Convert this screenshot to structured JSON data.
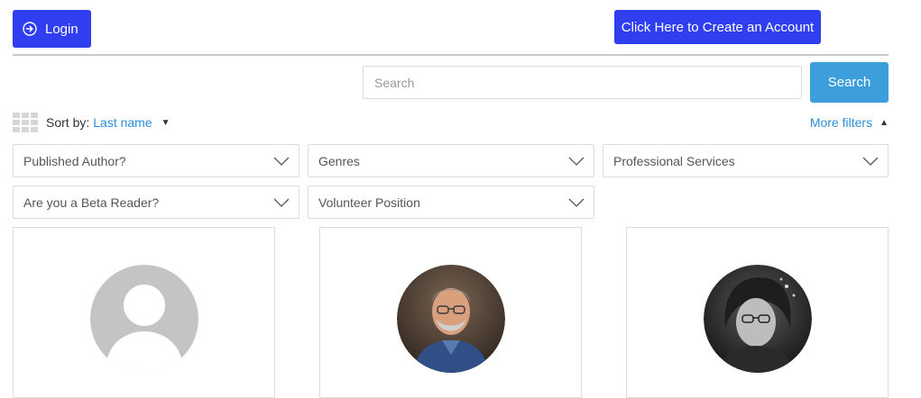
{
  "header": {
    "login_label": "Login",
    "create_account_label": "Click Here to Create an Account"
  },
  "search": {
    "placeholder": "Search",
    "button_label": "Search"
  },
  "sort": {
    "label": "Sort by:",
    "value": "Last name"
  },
  "more_filters_label": "More filters",
  "filters": [
    "Published Author?",
    "Genres",
    "Professional Services",
    "Are you a Beta Reader?",
    "Volunteer Position"
  ],
  "icons": {
    "login": "circle-arrow-right-icon",
    "grid": "grid-view-icon",
    "sort_caret": "caret-down-icon",
    "filters_caret": "caret-up-icon",
    "select_chevron": "chevron-down-icon",
    "placeholder_avatar": "default-user-avatar-icon"
  },
  "colors": {
    "primary_button": "#2f3ff0",
    "search_button": "#3c9fdc",
    "link": "#2b8fd6"
  }
}
